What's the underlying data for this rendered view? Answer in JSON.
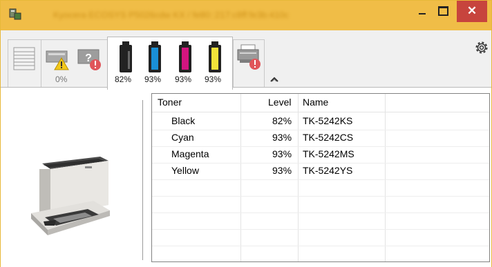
{
  "window": {
    "title": "Kyocera ECOSYS P5026cdw KX / fe80::217:c8ff:fe3b:410c",
    "controls": {
      "minimize": "minimize",
      "maximize": "maximize",
      "close": "✕"
    }
  },
  "toolbar": {
    "status_percent": "0%",
    "toner_levels": [
      {
        "name": "Black",
        "label": "82%",
        "color": "#1a1a1a"
      },
      {
        "name": "Cyan",
        "label": "93%",
        "color": "#1a8fd6"
      },
      {
        "name": "Magenta",
        "label": "93%",
        "color": "#d3157f"
      },
      {
        "name": "Yellow",
        "label": "93%",
        "color": "#f2e23a"
      }
    ]
  },
  "table": {
    "columns": [
      "Toner",
      "Level",
      "Name"
    ],
    "rows": [
      {
        "toner": "Black",
        "level": "82%",
        "name": "TK-5242KS"
      },
      {
        "toner": "Cyan",
        "level": "93%",
        "name": "TK-5242CS"
      },
      {
        "toner": "Magenta",
        "level": "93%",
        "name": "TK-5242MS"
      },
      {
        "toner": "Yellow",
        "level": "93%",
        "name": "TK-5242YS"
      }
    ]
  }
}
